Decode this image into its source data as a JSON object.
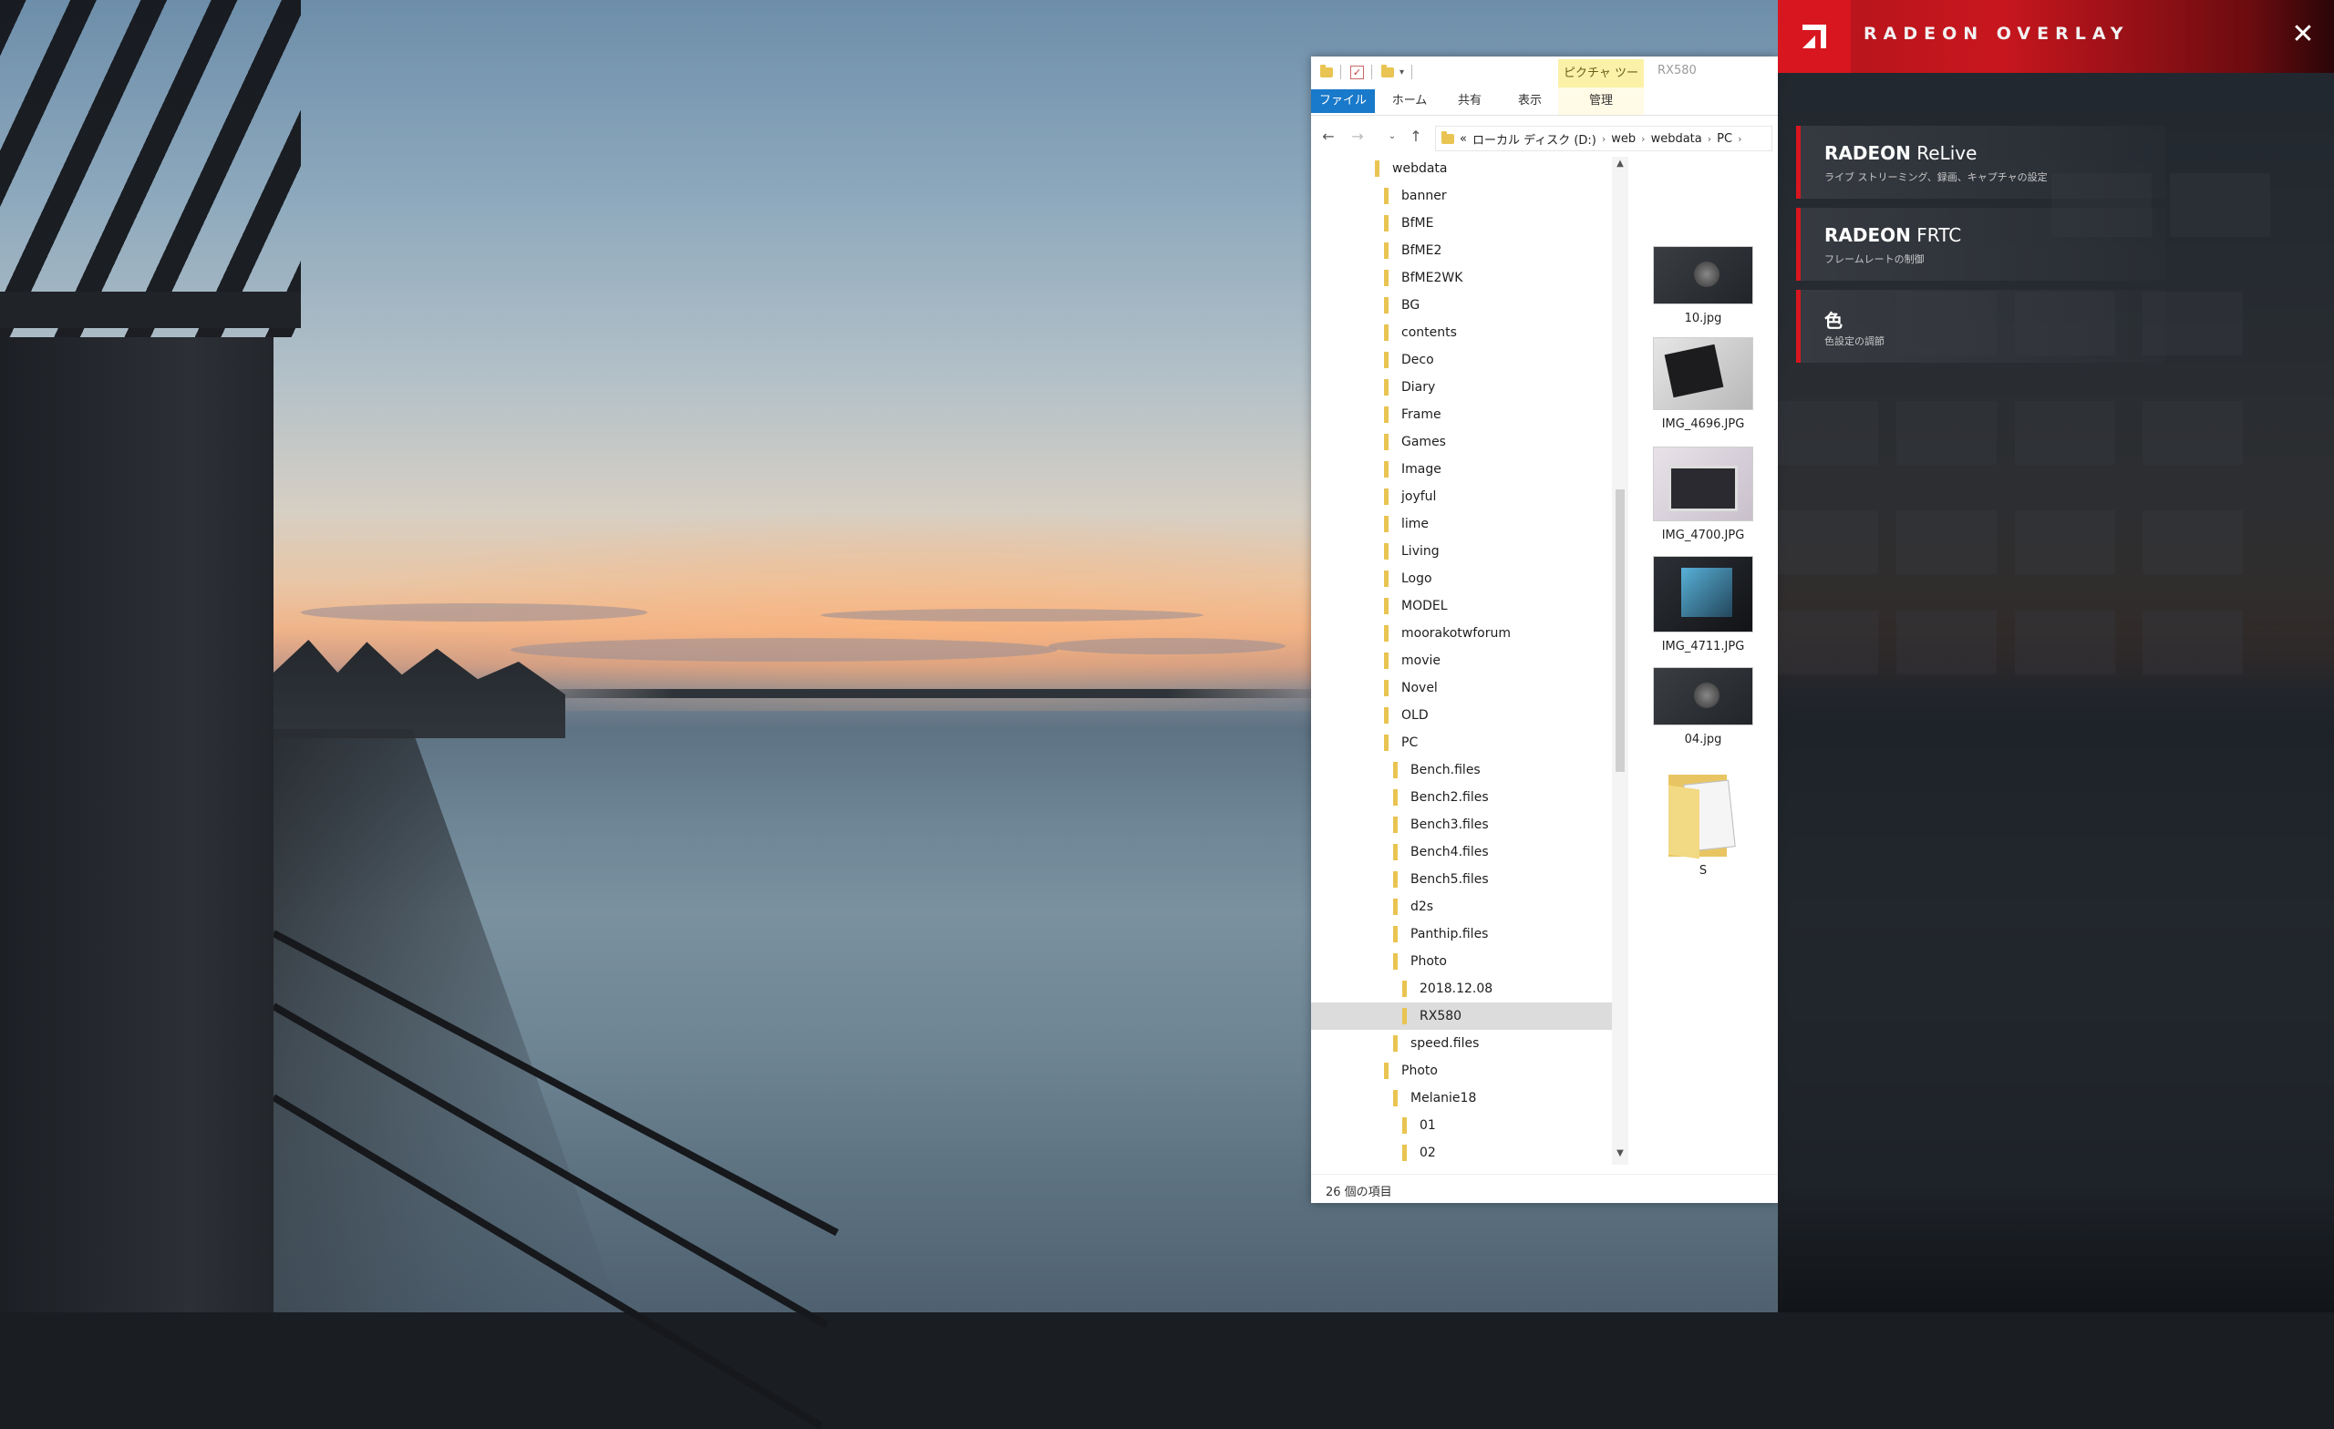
{
  "explorer": {
    "picture_tools": "ピクチャ ツール",
    "window_title": "RX580",
    "tabs": [
      "ファイル",
      "ホーム",
      "共有",
      "表示",
      "管理"
    ],
    "address": {
      "lead": "«",
      "segments": [
        "ローカル ディスク (D:)",
        "web",
        "webdata",
        "PC"
      ]
    },
    "tree": [
      {
        "label": "webdata",
        "level": 0
      },
      {
        "label": "banner",
        "level": 1
      },
      {
        "label": "BfME",
        "level": 1
      },
      {
        "label": "BfME2",
        "level": 1
      },
      {
        "label": "BfME2WK",
        "level": 1
      },
      {
        "label": "BG",
        "level": 1
      },
      {
        "label": "contents",
        "level": 1
      },
      {
        "label": "Deco",
        "level": 1
      },
      {
        "label": "Diary",
        "level": 1
      },
      {
        "label": "Frame",
        "level": 1
      },
      {
        "label": "Games",
        "level": 1
      },
      {
        "label": "Image",
        "level": 1
      },
      {
        "label": "joyful",
        "level": 1
      },
      {
        "label": "lime",
        "level": 1
      },
      {
        "label": "Living",
        "level": 1
      },
      {
        "label": "Logo",
        "level": 1
      },
      {
        "label": "MODEL",
        "level": 1
      },
      {
        "label": "moorakotwforum",
        "level": 1
      },
      {
        "label": "movie",
        "level": 1
      },
      {
        "label": "Novel",
        "level": 1
      },
      {
        "label": "OLD",
        "level": 1
      },
      {
        "label": "PC",
        "level": 1
      },
      {
        "label": "Bench.files",
        "level": 2
      },
      {
        "label": "Bench2.files",
        "level": 2
      },
      {
        "label": "Bench3.files",
        "level": 2
      },
      {
        "label": "Bench4.files",
        "level": 2
      },
      {
        "label": "Bench5.files",
        "level": 2
      },
      {
        "label": "d2s",
        "level": 2
      },
      {
        "label": "Panthip.files",
        "level": 2
      },
      {
        "label": "Photo",
        "level": 2
      },
      {
        "label": "2018.12.08",
        "level": 3
      },
      {
        "label": "RX580",
        "level": 3,
        "selected": true
      },
      {
        "label": "speed.files",
        "level": 2
      },
      {
        "label": "Photo",
        "level": 1
      },
      {
        "label": "Melanie18",
        "level": 2
      },
      {
        "label": "01",
        "level": 3
      },
      {
        "label": "02",
        "level": 3
      }
    ],
    "files": [
      {
        "name": "10.jpg",
        "thumb": "gpu-a"
      },
      {
        "name": "IMG_4696.JPG",
        "thumb": "gpu-b"
      },
      {
        "name": "IMG_4700.JPG",
        "thumb": "gpu-c"
      },
      {
        "name": "IMG_4711.JPG",
        "thumb": "gpu-d"
      },
      {
        "name": "04.jpg",
        "thumb": "gpu-a"
      },
      {
        "name": "S",
        "thumb": "folder"
      }
    ],
    "status": "26 個の項目"
  },
  "overlay": {
    "title": "RADEON OVERLAY",
    "close_glyph": "✕",
    "items": [
      {
        "title_bold": "RADEON",
        "title_light": " ReLive",
        "subtitle": "ライブ ストリーミング、録画、キャプチャの設定"
      },
      {
        "title_bold": "RADEON",
        "title_light": " FRTC",
        "subtitle": "フレームレートの制御"
      },
      {
        "title_bold": "色",
        "title_light": "",
        "subtitle": "色設定の調節"
      }
    ],
    "accent": "#d8161f"
  }
}
